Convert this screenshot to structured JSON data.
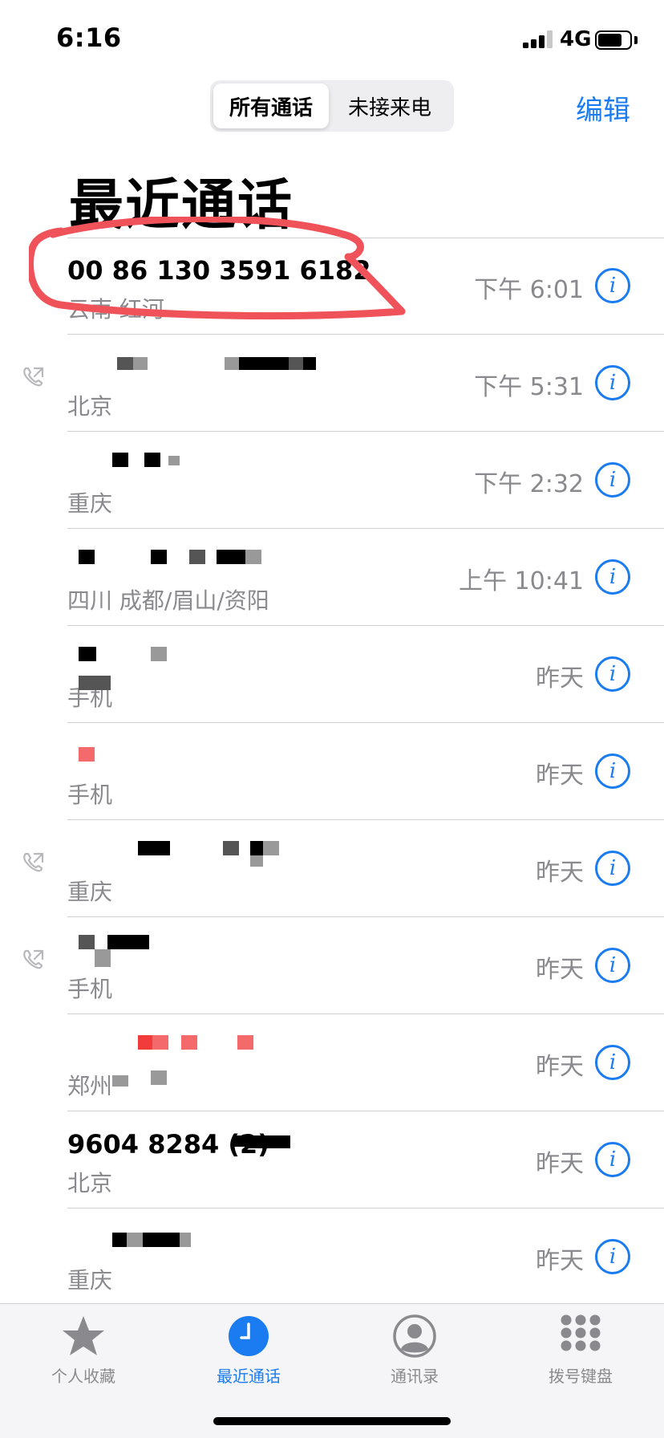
{
  "status_bar": {
    "time": "6:16",
    "network": "4G",
    "battery_level": 0.75
  },
  "header": {
    "segments": {
      "all": "所有通话",
      "missed": "未接来电"
    },
    "edit_label": "编辑",
    "title": "最近通话"
  },
  "calls": [
    {
      "name": "00 86 130 3591 6182",
      "sub": "云南 红河",
      "time": "下午 6:01",
      "outgoing": false,
      "missed": false
    },
    {
      "name": "",
      "sub": "北京",
      "time": "下午 5:31",
      "outgoing": true,
      "missed": false
    },
    {
      "name": "",
      "sub": "重庆",
      "time": "下午 2:32",
      "outgoing": false,
      "missed": false
    },
    {
      "name": "",
      "sub": "四川 成都/眉山/资阳",
      "time": "上午 10:41",
      "outgoing": false,
      "missed": false
    },
    {
      "name": "",
      "sub": "手机",
      "time": "昨天",
      "outgoing": false,
      "missed": false
    },
    {
      "name": "",
      "sub": "手机",
      "time": "昨天",
      "outgoing": false,
      "missed": false
    },
    {
      "name": "",
      "sub": "重庆",
      "time": "昨天",
      "outgoing": true,
      "missed": false
    },
    {
      "name": "",
      "sub": "手机",
      "time": "昨天",
      "outgoing": true,
      "missed": false
    },
    {
      "name": "",
      "sub": "郑州",
      "time": "昨天",
      "outgoing": false,
      "missed": true
    },
    {
      "name": "9604 8284 (2)",
      "sub": "北京",
      "time": "昨天",
      "outgoing": false,
      "missed": false
    },
    {
      "name": "",
      "sub": "重庆",
      "time": "昨天",
      "outgoing": false,
      "missed": false
    }
  ],
  "info_glyph": "i",
  "tabs": [
    {
      "label": "个人收藏",
      "icon": "star-icon"
    },
    {
      "label": "最近通话",
      "icon": "clock-icon"
    },
    {
      "label": "通讯录",
      "icon": "contact-icon"
    },
    {
      "label": "拨号键盘",
      "icon": "keypad-icon"
    }
  ],
  "colors": {
    "accent": "#1a7cf0",
    "missed": "#ff3b30",
    "secondary_text": "#8a8a8e",
    "annotation": "#f0525a"
  }
}
